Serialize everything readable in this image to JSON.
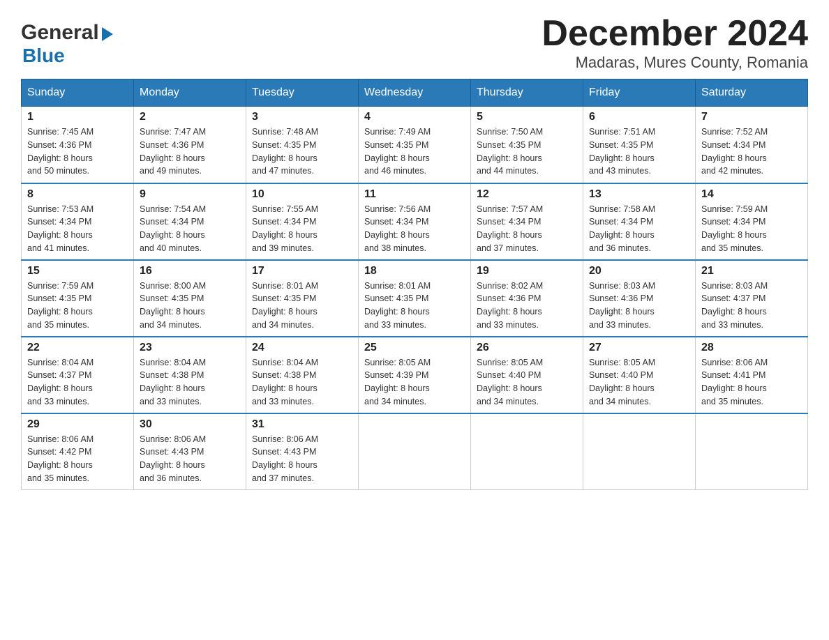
{
  "logo": {
    "line1": "General",
    "arrow": "▶",
    "line2": "Blue"
  },
  "title": "December 2024",
  "subtitle": "Madaras, Mures County, Romania",
  "days_of_week": [
    "Sunday",
    "Monday",
    "Tuesday",
    "Wednesday",
    "Thursday",
    "Friday",
    "Saturday"
  ],
  "weeks": [
    [
      {
        "day": "1",
        "sunrise": "7:45 AM",
        "sunset": "4:36 PM",
        "daylight": "8 hours and 50 minutes."
      },
      {
        "day": "2",
        "sunrise": "7:47 AM",
        "sunset": "4:36 PM",
        "daylight": "8 hours and 49 minutes."
      },
      {
        "day": "3",
        "sunrise": "7:48 AM",
        "sunset": "4:35 PM",
        "daylight": "8 hours and 47 minutes."
      },
      {
        "day": "4",
        "sunrise": "7:49 AM",
        "sunset": "4:35 PM",
        "daylight": "8 hours and 46 minutes."
      },
      {
        "day": "5",
        "sunrise": "7:50 AM",
        "sunset": "4:35 PM",
        "daylight": "8 hours and 44 minutes."
      },
      {
        "day": "6",
        "sunrise": "7:51 AM",
        "sunset": "4:35 PM",
        "daylight": "8 hours and 43 minutes."
      },
      {
        "day": "7",
        "sunrise": "7:52 AM",
        "sunset": "4:34 PM",
        "daylight": "8 hours and 42 minutes."
      }
    ],
    [
      {
        "day": "8",
        "sunrise": "7:53 AM",
        "sunset": "4:34 PM",
        "daylight": "8 hours and 41 minutes."
      },
      {
        "day": "9",
        "sunrise": "7:54 AM",
        "sunset": "4:34 PM",
        "daylight": "8 hours and 40 minutes."
      },
      {
        "day": "10",
        "sunrise": "7:55 AM",
        "sunset": "4:34 PM",
        "daylight": "8 hours and 39 minutes."
      },
      {
        "day": "11",
        "sunrise": "7:56 AM",
        "sunset": "4:34 PM",
        "daylight": "8 hours and 38 minutes."
      },
      {
        "day": "12",
        "sunrise": "7:57 AM",
        "sunset": "4:34 PM",
        "daylight": "8 hours and 37 minutes."
      },
      {
        "day": "13",
        "sunrise": "7:58 AM",
        "sunset": "4:34 PM",
        "daylight": "8 hours and 36 minutes."
      },
      {
        "day": "14",
        "sunrise": "7:59 AM",
        "sunset": "4:34 PM",
        "daylight": "8 hours and 35 minutes."
      }
    ],
    [
      {
        "day": "15",
        "sunrise": "7:59 AM",
        "sunset": "4:35 PM",
        "daylight": "8 hours and 35 minutes."
      },
      {
        "day": "16",
        "sunrise": "8:00 AM",
        "sunset": "4:35 PM",
        "daylight": "8 hours and 34 minutes."
      },
      {
        "day": "17",
        "sunrise": "8:01 AM",
        "sunset": "4:35 PM",
        "daylight": "8 hours and 34 minutes."
      },
      {
        "day": "18",
        "sunrise": "8:01 AM",
        "sunset": "4:35 PM",
        "daylight": "8 hours and 33 minutes."
      },
      {
        "day": "19",
        "sunrise": "8:02 AM",
        "sunset": "4:36 PM",
        "daylight": "8 hours and 33 minutes."
      },
      {
        "day": "20",
        "sunrise": "8:03 AM",
        "sunset": "4:36 PM",
        "daylight": "8 hours and 33 minutes."
      },
      {
        "day": "21",
        "sunrise": "8:03 AM",
        "sunset": "4:37 PM",
        "daylight": "8 hours and 33 minutes."
      }
    ],
    [
      {
        "day": "22",
        "sunrise": "8:04 AM",
        "sunset": "4:37 PM",
        "daylight": "8 hours and 33 minutes."
      },
      {
        "day": "23",
        "sunrise": "8:04 AM",
        "sunset": "4:38 PM",
        "daylight": "8 hours and 33 minutes."
      },
      {
        "day": "24",
        "sunrise": "8:04 AM",
        "sunset": "4:38 PM",
        "daylight": "8 hours and 33 minutes."
      },
      {
        "day": "25",
        "sunrise": "8:05 AM",
        "sunset": "4:39 PM",
        "daylight": "8 hours and 34 minutes."
      },
      {
        "day": "26",
        "sunrise": "8:05 AM",
        "sunset": "4:40 PM",
        "daylight": "8 hours and 34 minutes."
      },
      {
        "day": "27",
        "sunrise": "8:05 AM",
        "sunset": "4:40 PM",
        "daylight": "8 hours and 34 minutes."
      },
      {
        "day": "28",
        "sunrise": "8:06 AM",
        "sunset": "4:41 PM",
        "daylight": "8 hours and 35 minutes."
      }
    ],
    [
      {
        "day": "29",
        "sunrise": "8:06 AM",
        "sunset": "4:42 PM",
        "daylight": "8 hours and 35 minutes."
      },
      {
        "day": "30",
        "sunrise": "8:06 AM",
        "sunset": "4:43 PM",
        "daylight": "8 hours and 36 minutes."
      },
      {
        "day": "31",
        "sunrise": "8:06 AM",
        "sunset": "4:43 PM",
        "daylight": "8 hours and 37 minutes."
      },
      null,
      null,
      null,
      null
    ]
  ],
  "labels": {
    "sunrise": "Sunrise:",
    "sunset": "Sunset:",
    "daylight": "Daylight:"
  }
}
